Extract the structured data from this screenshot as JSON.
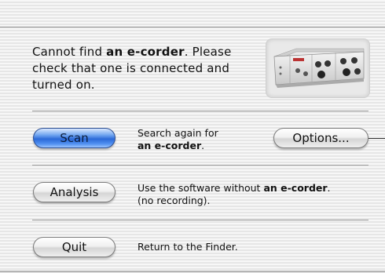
{
  "message": {
    "prefix": "Cannot find ",
    "device_name": "an e-corder",
    "suffix_line1": ". Please",
    "line2": "check that one is connected and",
    "line3": "turned on."
  },
  "buttons": {
    "scan": "Scan",
    "options": "Options...",
    "analysis": "Analysis",
    "quit": "Quit"
  },
  "descriptions": {
    "scan_line1": "Search again for",
    "scan_line2_bold": "an e-corder",
    "scan_line2_end": ".",
    "analysis_prefix": "Use the software without ",
    "analysis_bold": "an e-corder",
    "analysis_end": ".",
    "analysis_line2": "(no recording).",
    "quit": "Return to the Finder."
  },
  "icons": {
    "device": "e-corder-hardware-image"
  },
  "colors": {
    "scan_button_blue": "#2c6ad8",
    "background_stripe": "#e6e6e6"
  }
}
